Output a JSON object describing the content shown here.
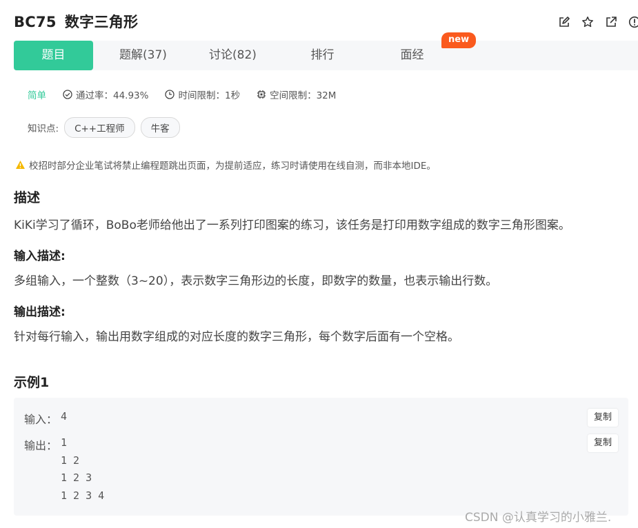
{
  "problem": {
    "id": "BC75",
    "title": "数字三角形"
  },
  "tabs": [
    {
      "label": "题目",
      "active": true
    },
    {
      "label": "题解(37)"
    },
    {
      "label": "讨论(82)"
    },
    {
      "label": "排行"
    },
    {
      "label": "面经"
    }
  ],
  "new_badge": "new",
  "meta": {
    "difficulty": "简单",
    "pass_rate": "通过率：44.93%",
    "time_limit": "时间限制：1秒",
    "space_limit": "空间限制：32M"
  },
  "knowledge": {
    "label": "知识点:",
    "tags": [
      "C++工程师",
      "牛客"
    ]
  },
  "warning": "校招时部分企业笔试将禁止编程题跳出页面，为提前适应，练习时请使用在线自测，而非本地IDE。",
  "description": {
    "heading": "描述",
    "text": "KiKi学习了循环，BoBo老师给他出了一系列打印图案的练习，该任务是打印用数字组成的数字三角形图案。"
  },
  "input_desc": {
    "heading": "输入描述:",
    "text": "多组输入，一个整数（3~20），表示数字三角形边的长度，即数字的数量，也表示输出行数。"
  },
  "output_desc": {
    "heading": "输出描述:",
    "text": "针对每行输入，输出用数字组成的对应长度的数字三角形，每个数字后面有一个空格。"
  },
  "example": {
    "heading": "示例1",
    "input_label": "输入：",
    "input_value": "4",
    "output_label": "输出：",
    "output_value": "1\n1 2\n1 2 3\n1 2 3 4",
    "copy_label": "复制"
  },
  "watermark": "CSDN @认真学习的小雅兰.",
  "colors": {
    "accent": "#32ca99",
    "badge": "#fa5a1e",
    "warning": "#f5b800"
  }
}
